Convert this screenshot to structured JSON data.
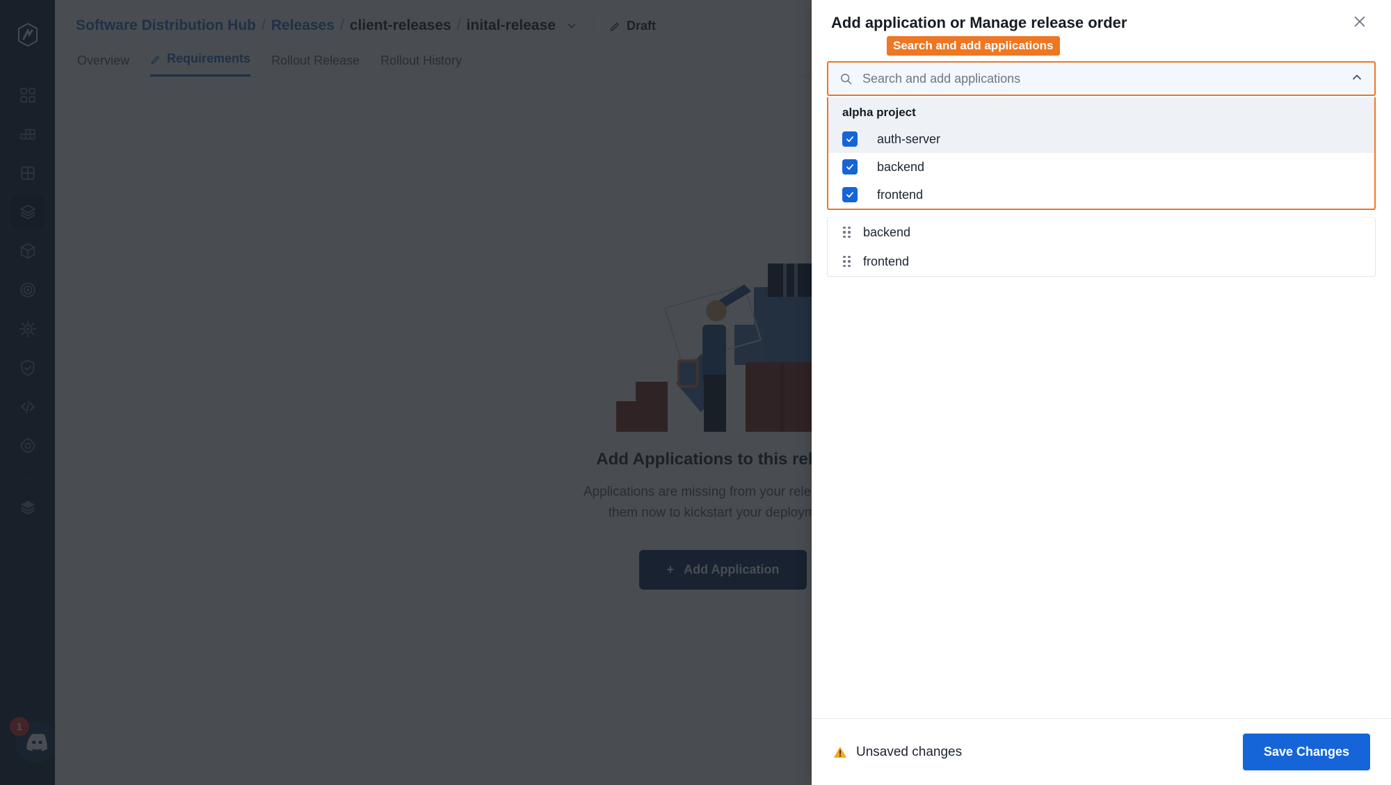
{
  "app": {
    "sidebar": {
      "logo_icon": "hexagon-logo-icon",
      "items": [
        {
          "icon": "apps-grid-icon",
          "name": "sidebar-item-dashboard",
          "active": false
        },
        {
          "icon": "blocks-stack-icon",
          "name": "sidebar-item-projects",
          "active": false
        },
        {
          "icon": "four-square-grid-icon",
          "name": "sidebar-item-environments",
          "active": false
        },
        {
          "icon": "box-layers-icon",
          "name": "sidebar-item-releases",
          "active": true
        },
        {
          "icon": "cube-icon",
          "name": "sidebar-item-artifacts",
          "active": false
        },
        {
          "icon": "target-radar-icon",
          "name": "sidebar-item-targets",
          "active": false
        },
        {
          "icon": "gear-sun-icon",
          "name": "sidebar-item-automation",
          "active": false
        },
        {
          "icon": "shield-check-icon",
          "name": "sidebar-item-security",
          "active": false
        },
        {
          "icon": "code-brackets-icon",
          "name": "sidebar-item-api",
          "active": false
        },
        {
          "icon": "settings-gear-icon",
          "name": "sidebar-item-settings",
          "active": false
        },
        {
          "icon": "layers-stack-icon",
          "name": "sidebar-item-storage",
          "active": false
        }
      ],
      "discord": {
        "icon": "discord-icon",
        "badge": "1"
      }
    },
    "breadcrumb": {
      "root": "Software Distribution Hub",
      "section": "Releases",
      "project": "client-releases",
      "current": "inital-release",
      "sep": "/",
      "chevron_icon": "chevron-down-icon"
    },
    "status": {
      "icon": "pencil-icon",
      "label": "Draft"
    },
    "tabs": [
      {
        "label": "Overview",
        "active": false,
        "icon": ""
      },
      {
        "label": "Requirements",
        "active": true,
        "icon": "pencil-icon"
      },
      {
        "label": "Rollout Release",
        "active": false,
        "icon": ""
      },
      {
        "label": "Rollout History",
        "active": false,
        "icon": ""
      }
    ],
    "empty_state": {
      "illustration": "person-packing-boxes-illustration",
      "title": "Add Applications to this release",
      "description_line1": "Applications are missing from your release. Add",
      "description_line2": "them now to kickstart your deployment.",
      "button_label": "Add Application",
      "button_icon": "plus-icon"
    }
  },
  "panel": {
    "title": "Add application or Manage release order",
    "close_icon": "close-icon",
    "tooltip_label": "Search and add applications",
    "search": {
      "placeholder": "Search and add applications",
      "value": "",
      "icon": "search-icon",
      "toggle_icon": "chevron-up-icon"
    },
    "dropdown": {
      "group_label": "alpha project",
      "options": [
        {
          "label": "auth-server",
          "checked": true,
          "hover": true
        },
        {
          "label": "backend",
          "checked": true,
          "hover": false
        },
        {
          "label": "frontend",
          "checked": true,
          "hover": false
        }
      ]
    },
    "order_list": {
      "handle_icon": "drag-handle-icon",
      "items": [
        {
          "label": "backend"
        },
        {
          "label": "frontend"
        }
      ]
    },
    "footer": {
      "status_icon": "warning-triangle-icon",
      "status_text": "Unsaved changes",
      "save_label": "Save Changes"
    }
  },
  "colors": {
    "accent_orange": "#ef7622",
    "primary_blue": "#1565d8",
    "link_blue": "#2f6fd0",
    "sidebar_navy": "#0b1f3a",
    "badge_red": "#e0322c",
    "warning_amber": "#f5a623"
  }
}
